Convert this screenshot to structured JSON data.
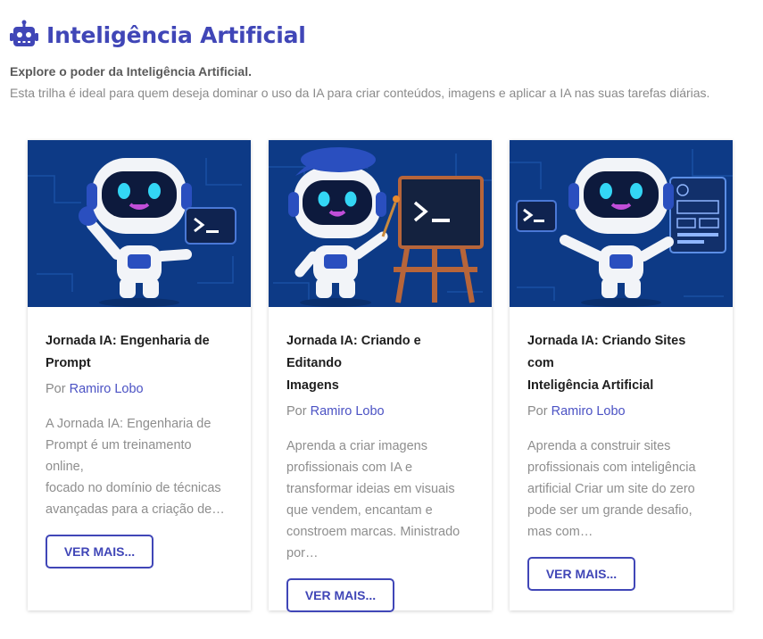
{
  "header": {
    "icon": "robot-icon",
    "title": "Inteligência Artificial",
    "subtitle": "Explore o poder da Inteligência Artificial.",
    "description": "Esta trilha é ideal para quem deseja dominar o uso da IA para criar conteúdos, imagens e aplicar a IA nas suas tarefas diárias."
  },
  "colors": {
    "accent": "#4046b7",
    "image_bg": "#0d3a86",
    "text_muted": "#8a8a8a"
  },
  "cards": [
    {
      "image": "robot-waving-terminal-illustration",
      "title_line1": "Jornada IA: Engenharia de",
      "title_line2": "Prompt",
      "author_prefix": "Por",
      "author": "Ramiro Lobo",
      "excerpt": [
        "A Jornada IA: Engenharia de",
        "Prompt é um treinamento online,",
        "focado no domínio de técnicas",
        "avançadas para a criação de…"
      ],
      "button": "VER MAIS..."
    },
    {
      "image": "robot-painter-easel-illustration",
      "title_line1": "Jornada IA: Criando e Editando",
      "title_line2": "Imagens",
      "author_prefix": "Por",
      "author": "Ramiro Lobo",
      "excerpt": [
        "Aprenda a criar imagens",
        "profissionais com IA e",
        "transformar ideias em visuais",
        "que vendem, encantam e",
        "constroem marcas. Ministrado",
        "por…"
      ],
      "button": "VER MAIS..."
    },
    {
      "image": "robot-website-builder-illustration",
      "title_line1": "Jornada IA: Criando Sites com",
      "title_line2": "Inteligência Artificial",
      "author_prefix": "Por",
      "author": "Ramiro Lobo",
      "excerpt": [
        "Aprenda a construir sites",
        "profissionais com inteligência",
        "artificial Criar um site do zero",
        "pode ser um grande desafio,",
        "mas com…"
      ],
      "button": "VER MAIS..."
    }
  ]
}
